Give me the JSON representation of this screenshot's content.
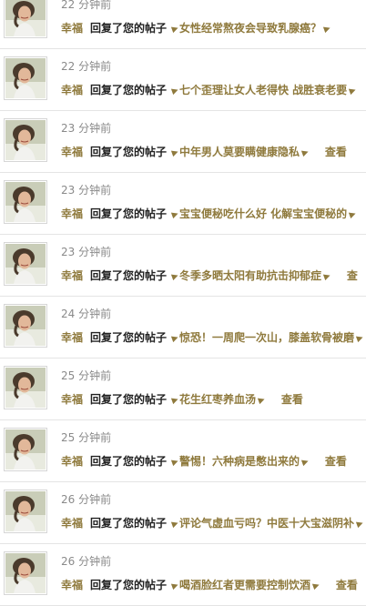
{
  "notifications": [
    {
      "time": "22 分钟前",
      "user": "幸福",
      "action": "回复了您的帖子",
      "post": "女性经常熬夜会导致乳腺癌？",
      "view": ""
    },
    {
      "time": "22 分钟前",
      "user": "幸福",
      "action": "回复了您的帖子",
      "post": "七个歪理让女人老得快 战胜衰老要",
      "view": ""
    },
    {
      "time": "23 分钟前",
      "user": "幸福",
      "action": "回复了您的帖子",
      "post": "中年男人莫要瞒健康隐私",
      "view": "查看"
    },
    {
      "time": "23 分钟前",
      "user": "幸福",
      "action": "回复了您的帖子",
      "post": "宝宝便秘吃什么好 化解宝宝便秘的",
      "view": ""
    },
    {
      "time": "23 分钟前",
      "user": "幸福",
      "action": "回复了您的帖子",
      "post": "冬季多晒太阳有助抗击抑郁症",
      "view": "查"
    },
    {
      "time": "24 分钟前",
      "user": "幸福",
      "action": "回复了您的帖子",
      "post": "惊恐！一周爬一次山，膝盖软骨被磨",
      "view": ""
    },
    {
      "time": "25 分钟前",
      "user": "幸福",
      "action": "回复了您的帖子",
      "post": "花生红枣养血汤",
      "view": "查看"
    },
    {
      "time": "25 分钟前",
      "user": "幸福",
      "action": "回复了您的帖子",
      "post": "警惕！六种病是憋出来的",
      "view": "查看"
    },
    {
      "time": "26 分钟前",
      "user": "幸福",
      "action": "回复了您的帖子",
      "post": "评论气虚血亏吗？中医十大宝滋阴补",
      "view": ""
    },
    {
      "time": "26 分钟前",
      "user": "幸福",
      "action": "回复了您的帖子",
      "post": "喝酒脸红者更需要控制饮酒",
      "view": "查看"
    }
  ],
  "colors": {
    "link": "#8f7a3d",
    "text": "#222222",
    "meta": "#8a8a8a"
  }
}
